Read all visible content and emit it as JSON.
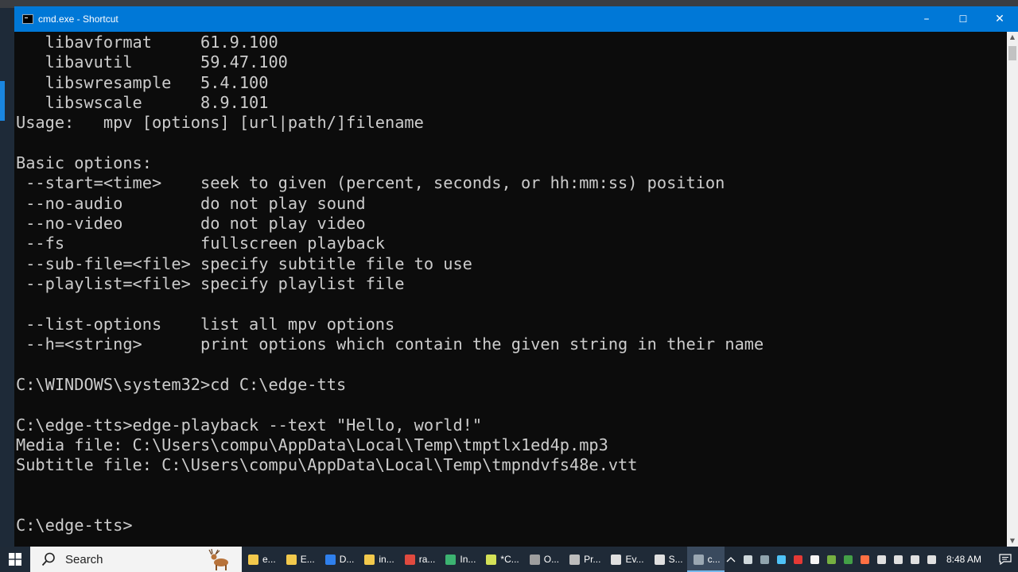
{
  "window": {
    "title": "cmd.exe - Shortcut",
    "controls": {
      "minimize": "–",
      "maximize": "☐",
      "close": "✕"
    }
  },
  "console": {
    "lines": [
      "   libavformat     61.9.100",
      "   libavutil       59.47.100",
      "   libswresample   5.4.100",
      "   libswscale      8.9.101",
      "Usage:   mpv [options] [url|path/]filename",
      "",
      "Basic options:",
      " --start=<time>    seek to given (percent, seconds, or hh:mm:ss) position",
      " --no-audio        do not play sound",
      " --no-video        do not play video",
      " --fs              fullscreen playback",
      " --sub-file=<file> specify subtitle file to use",
      " --playlist=<file> specify playlist file",
      "",
      " --list-options    list all mpv options",
      " --h=<string>      print options which contain the given string in their name",
      "",
      "C:\\WINDOWS\\system32>cd C:\\edge-tts",
      "",
      "C:\\edge-tts>edge-playback --text \"Hello, world!\"",
      "Media file: C:\\Users\\compu\\AppData\\Local\\Temp\\tmptlx1ed4p.mp3",
      "Subtitle file: C:\\Users\\compu\\AppData\\Local\\Temp\\tmpndvfs48e.vtt",
      "",
      "",
      "C:\\edge-tts>"
    ]
  },
  "scrollbar": {
    "up_icon": "▲",
    "down_icon": "▼"
  },
  "taskbar": {
    "search_label": "Search",
    "tasks": [
      {
        "label": "e...",
        "color": "#f2c94c"
      },
      {
        "label": "E...",
        "color": "#f2c94c"
      },
      {
        "label": "D...",
        "color": "#2f80ed"
      },
      {
        "label": "in...",
        "color": "#f2c94c"
      },
      {
        "label": "ra...",
        "color": "#e04a3f"
      },
      {
        "label": "In...",
        "color": "#3cb371"
      },
      {
        "label": "*C...",
        "color": "#d4e157"
      },
      {
        "label": "O...",
        "color": "#9e9e9e"
      },
      {
        "label": "Pr...",
        "color": "#bdbdbd"
      },
      {
        "label": "Ev...",
        "color": "#e0e0e0"
      },
      {
        "label": "S...",
        "color": "#e0e0e0"
      },
      {
        "label": "c...",
        "color": "#9aa7b2"
      }
    ],
    "tray_icons": [
      "#cfd8dc",
      "#90a4ae",
      "#4fc3f7",
      "#e53935",
      "#f5f5f5",
      "#76b041",
      "#43a047",
      "#ff7043",
      "#e0e0e0",
      "#e0e0e0",
      "#e0e0e0",
      "#e0e0e0"
    ],
    "clock": "8:48 AM",
    "colors": {
      "titlebar": "#0078d7",
      "console_bg": "#0c0c0c",
      "console_text": "#cccccc",
      "taskbar": "#1f2a37"
    }
  }
}
